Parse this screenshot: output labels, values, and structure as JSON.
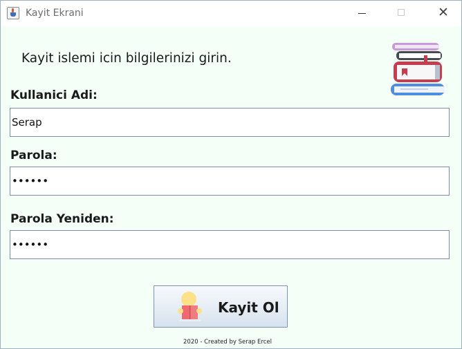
{
  "window": {
    "title": "Kayit Ekrani"
  },
  "header": {
    "instruction": "Kayit islemi icin bilgilerinizi girin."
  },
  "form": {
    "username_label": "Kullanici Adi:",
    "username_value": "Serap",
    "password_label": "Parola:",
    "password_value": "••••••",
    "password_repeat_label": "Parola Yeniden:",
    "password_repeat_value": "••••••",
    "submit_label": "Kayit Ol"
  },
  "footer": {
    "credit": "2020 - Created by Serap Ercel"
  },
  "icons": {
    "app": "java-cup-icon",
    "decor": "books-stack-icon",
    "submit": "reading-person-icon"
  }
}
